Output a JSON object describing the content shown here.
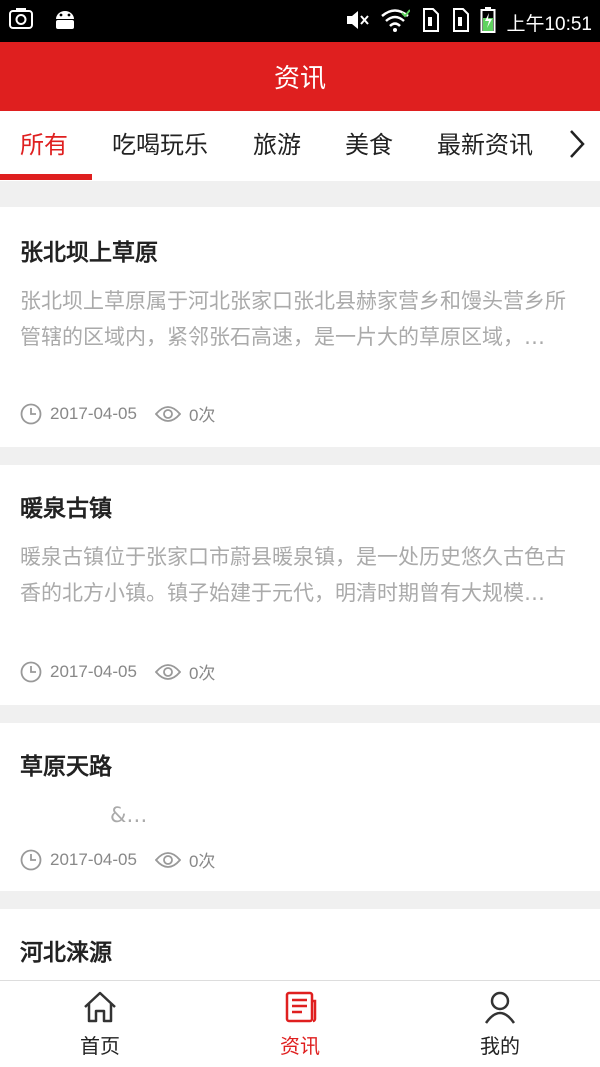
{
  "status_bar": {
    "time": "上午10:51"
  },
  "header": {
    "title": "资讯"
  },
  "tabs": [
    {
      "label": "所有",
      "active": true
    },
    {
      "label": "吃喝玩乐",
      "active": false
    },
    {
      "label": "旅游",
      "active": false
    },
    {
      "label": "美食",
      "active": false
    },
    {
      "label": "最新资讯",
      "active": false
    }
  ],
  "articles": [
    {
      "title": "张北坝上草原",
      "summary": "张北坝上草原属于河北张家口张北县赫家营乡和馒头营乡所管辖的区域内，紧邻张石高速，是一片大的草原区域，…",
      "date": "2017-04-05",
      "views": "0次"
    },
    {
      "title": "暖泉古镇",
      "summary": "暖泉古镇位于张家口市蔚县暖泉镇，是一处历史悠久古色古香的北方小镇。镇子始建于元代，明清时期曾有大规模…",
      "date": "2017-04-05",
      "views": "0次"
    },
    {
      "title": "草原天路",
      "summary": "&…",
      "date": "2017-04-05",
      "views": "0次"
    },
    {
      "title": "河北涞源",
      "summary": "",
      "date": "",
      "views": ""
    }
  ],
  "bottom_nav": [
    {
      "label": "首页",
      "icon": "home-icon",
      "active": false
    },
    {
      "label": "资讯",
      "icon": "news-icon",
      "active": true
    },
    {
      "label": "我的",
      "icon": "person-icon",
      "active": false
    }
  ],
  "colors": {
    "accent": "#df1f1f",
    "background": "#f0f0f0",
    "muted_text": "#aaaaaa"
  }
}
